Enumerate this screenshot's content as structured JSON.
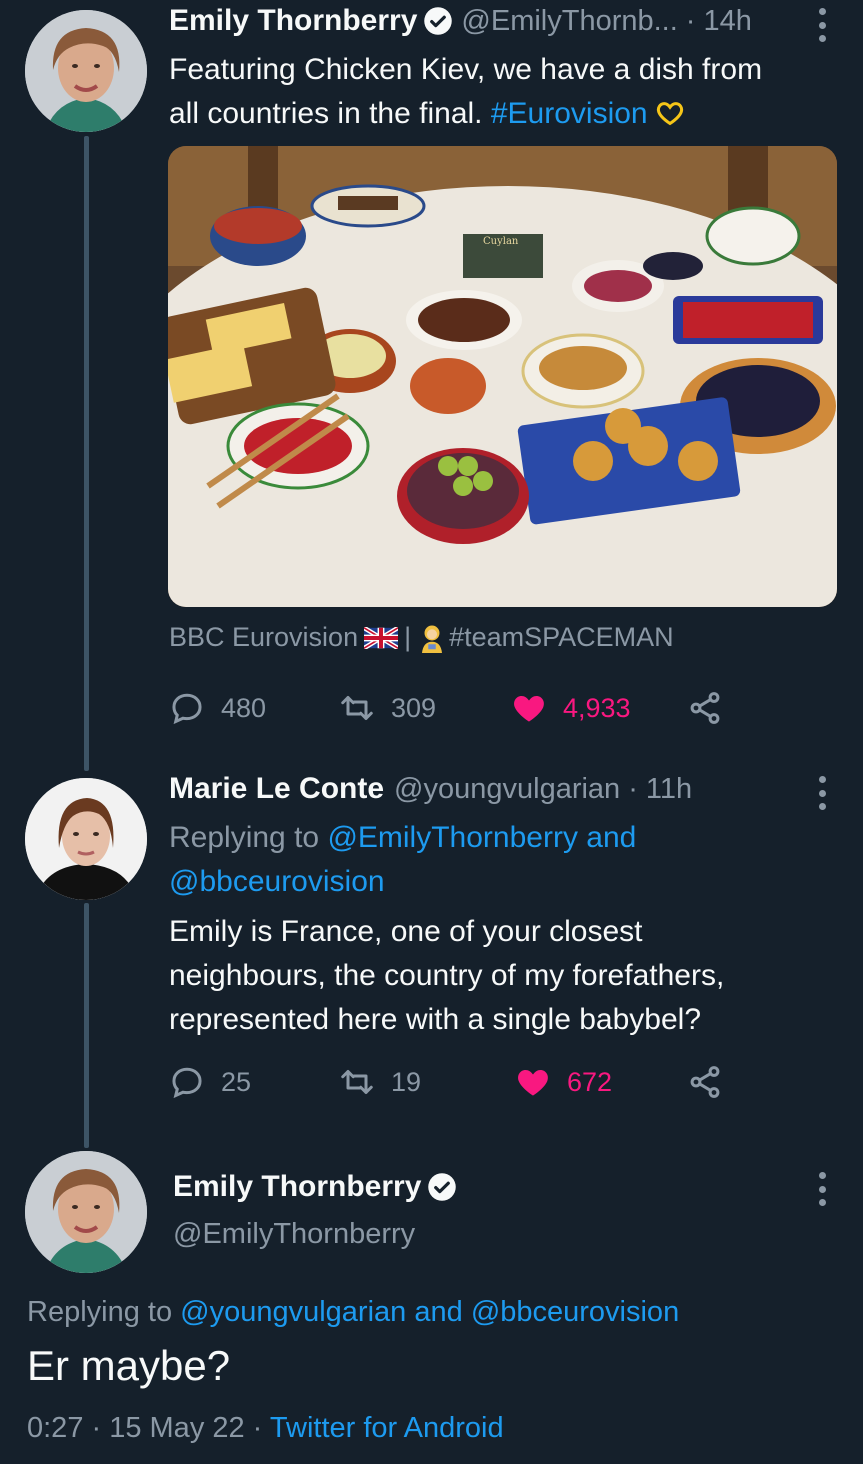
{
  "tweet1": {
    "name": "Emily Thornberry",
    "handle": "@EmilyThornb...",
    "time": "· 14h",
    "text_line1": "Featuring Chicken Kiev, we have a dish from",
    "text_line2_plain": "all countries in the final.",
    "hashtag": "#Eurovision",
    "source_prefix": "BBC Eurovision",
    "source_sep": "|",
    "source_tag": "#teamSPACEMAN",
    "replies": "480",
    "retweets": "309",
    "likes": "4,933",
    "photo_label": "Cuylan"
  },
  "tweet2": {
    "name": "Marie Le Conte",
    "handle": "@youngvulgarian",
    "time": "· 11h",
    "replying_prefix": "Replying to",
    "replying_to1": "@EmilyThornberry",
    "replying_and": "and",
    "replying_to2": "@bbceurovision",
    "text_line1": "Emily is France, one of your closest",
    "text_line2": "neighbours, the country of my forefathers,",
    "text_line3": "represented here with a single babybel?",
    "replies": "25",
    "retweets": "19",
    "likes": "672"
  },
  "tweet3": {
    "name": "Emily Thornberry",
    "handle": "@EmilyThornberry",
    "replying_prefix": "Replying to",
    "replying_to1": "@youngvulgarian",
    "replying_and": "and",
    "replying_to2": "@bbceurovision",
    "text": "Er maybe?",
    "timestamp": "0:27 · 15 May 22 ·",
    "client": "Twitter for Android"
  },
  "icons": {
    "verified": "verified-badge-icon",
    "more": "more-vertical-icon",
    "reply": "reply-icon",
    "retweet": "retweet-icon",
    "like": "heart-icon",
    "share": "share-icon"
  },
  "colors": {
    "background": "#15202b",
    "link": "#1d9bf0",
    "like": "#f91880",
    "muted": "#8b98a5",
    "heart_emoji": "#f5c518"
  }
}
